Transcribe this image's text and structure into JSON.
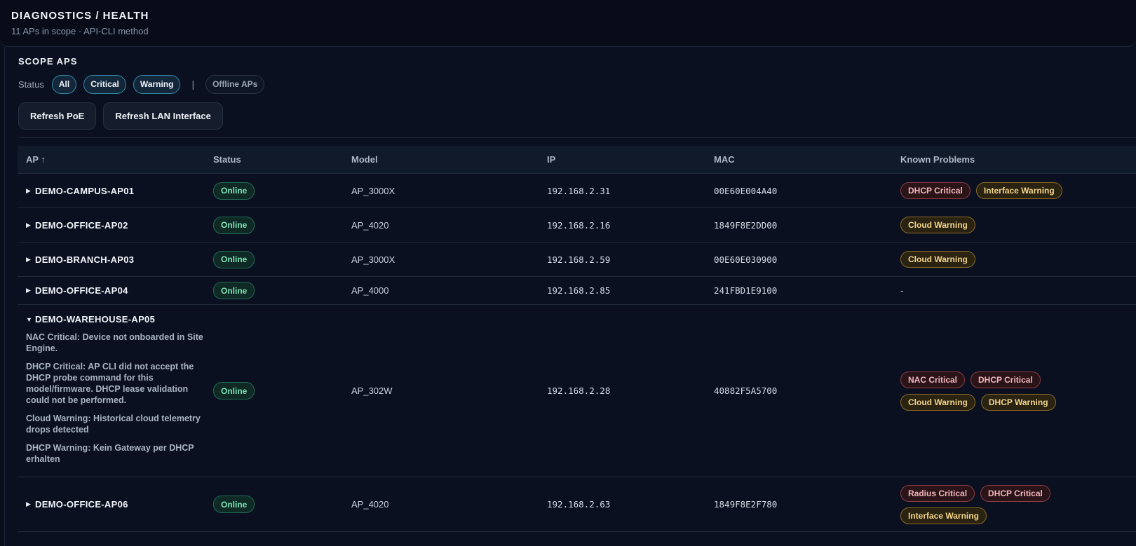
{
  "header": {
    "title": "DIAGNOSTICS / HEALTH",
    "subtitle": "11 APs in scope · API-CLI method"
  },
  "scope": {
    "title": "SCOPE APS",
    "filter_label": "Status",
    "filters": [
      "All",
      "Critical",
      "Warning"
    ],
    "divider": "|",
    "offline_filter": "Offline APs",
    "buttons": [
      "Refresh PoE",
      "Refresh LAN Interface"
    ]
  },
  "table": {
    "headers": [
      "AP ↑",
      "Status",
      "Model",
      "IP",
      "MAC",
      "Known Problems"
    ],
    "rows": [
      {
        "expanded_icon": "▶",
        "name": "DEMO-CAMPUS-AP01",
        "status": "Online",
        "model": "AP_3000X",
        "ip": "192.168.2.31",
        "mac": "00E60E004A40",
        "problems": [
          {
            "label": "DHCP Critical",
            "level": "critical"
          },
          {
            "label": "Interface Warning",
            "level": "warning"
          }
        ]
      },
      {
        "expanded_icon": "▶",
        "name": "DEMO-OFFICE-AP02",
        "status": "Online",
        "model": "AP_4020",
        "ip": "192.168.2.16",
        "mac": "1849F8E2DD00",
        "problems": [
          {
            "label": "Cloud Warning",
            "level": "warning"
          }
        ]
      },
      {
        "expanded_icon": "▶",
        "name": "DEMO-BRANCH-AP03",
        "status": "Online",
        "model": "AP_3000X",
        "ip": "192.168.2.59",
        "mac": "00E60E030900",
        "problems": [
          {
            "label": "Cloud Warning",
            "level": "warning"
          }
        ]
      },
      {
        "expanded_icon": "▶",
        "name": "DEMO-OFFICE-AP04",
        "status": "Online",
        "model": "AP_4000",
        "ip": "192.168.2.85",
        "mac": "241FBD1E9100",
        "no_problems": "-"
      },
      {
        "expanded_icon": "▼",
        "name": "DEMO-WAREHOUSE-AP05",
        "status": "Online",
        "model": "AP_302W",
        "ip": "192.168.2.28",
        "mac": "40882F5A5700",
        "details": [
          "NAC Critical: Device not onboarded in Site Engine.",
          "DHCP Critical: AP CLI did not accept the DHCP probe command for this model/firmware. DHCP lease validation could not be performed.",
          "Cloud Warning: Historical cloud telemetry drops detected",
          "DHCP Warning: Kein Gateway per DHCP erhalten"
        ],
        "problems": [
          {
            "label": "NAC Critical",
            "level": "critical"
          },
          {
            "label": "DHCP Critical",
            "level": "critical"
          },
          {
            "label": "Cloud Warning",
            "level": "warning"
          },
          {
            "label": "DHCP Warning",
            "level": "warning"
          }
        ]
      },
      {
        "expanded_icon": "▶",
        "name": "DEMO-OFFICE-AP06",
        "status": "Online",
        "model": "AP_4020",
        "ip": "192.168.2.63",
        "mac": "1849F8E2F780",
        "problems": [
          {
            "label": "Radius Critical",
            "level": "critical"
          },
          {
            "label": "DHCP Critical",
            "level": "critical"
          },
          {
            "label": "Interface Warning",
            "level": "warning"
          }
        ]
      }
    ]
  },
  "colors": {
    "accent": "#2f8ea8",
    "online": "#7ee3b8",
    "critical": "#f4b6bd",
    "warning": "#f4d58a"
  }
}
